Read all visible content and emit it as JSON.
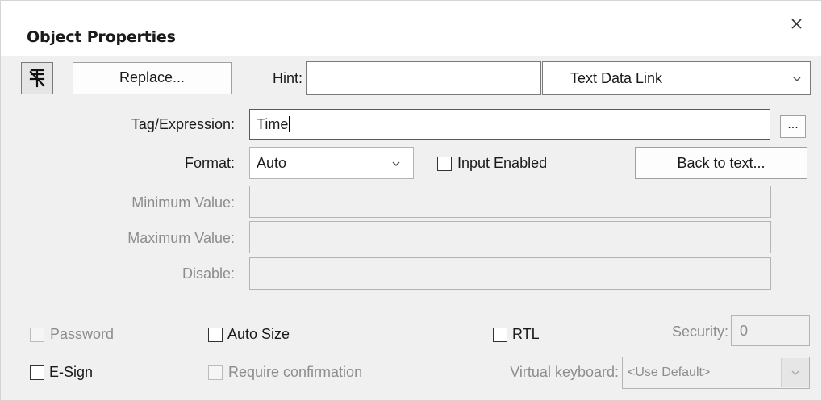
{
  "dialog": {
    "title": "Object Properties"
  },
  "toolbar": {
    "replace_label": "Replace...",
    "hint_label": "Hint:",
    "hint_value": "",
    "type_value": "Text Data Link"
  },
  "form": {
    "tag_label": "Tag/Expression:",
    "tag_value": "Time",
    "tag_browse_label": "...",
    "format_label": "Format:",
    "format_value": "Auto",
    "input_enabled_label": "Input Enabled",
    "back_to_text_label": "Back to text...",
    "min_label": "Minimum Value:",
    "min_value": "",
    "max_label": "Maximum Value:",
    "max_value": "",
    "disable_label": "Disable:",
    "disable_value": ""
  },
  "options": {
    "password_label": "Password",
    "auto_size_label": "Auto Size",
    "rtl_label": "RTL",
    "security_label": "Security:",
    "security_value": "0",
    "esign_label": "E-Sign",
    "require_confirmation_label": "Require confirmation",
    "virtual_keyboard_label": "Virtual keyboard:",
    "virtual_keyboard_value": "<Use Default>"
  },
  "icons": {
    "close": "close-icon",
    "pin": "pin-icon",
    "dropdown": "chevron-down-icon"
  },
  "colors": {
    "window_bg": "#f0f0f0",
    "titlebar_bg": "#ffffff",
    "disabled_text": "#8d8d8d"
  }
}
